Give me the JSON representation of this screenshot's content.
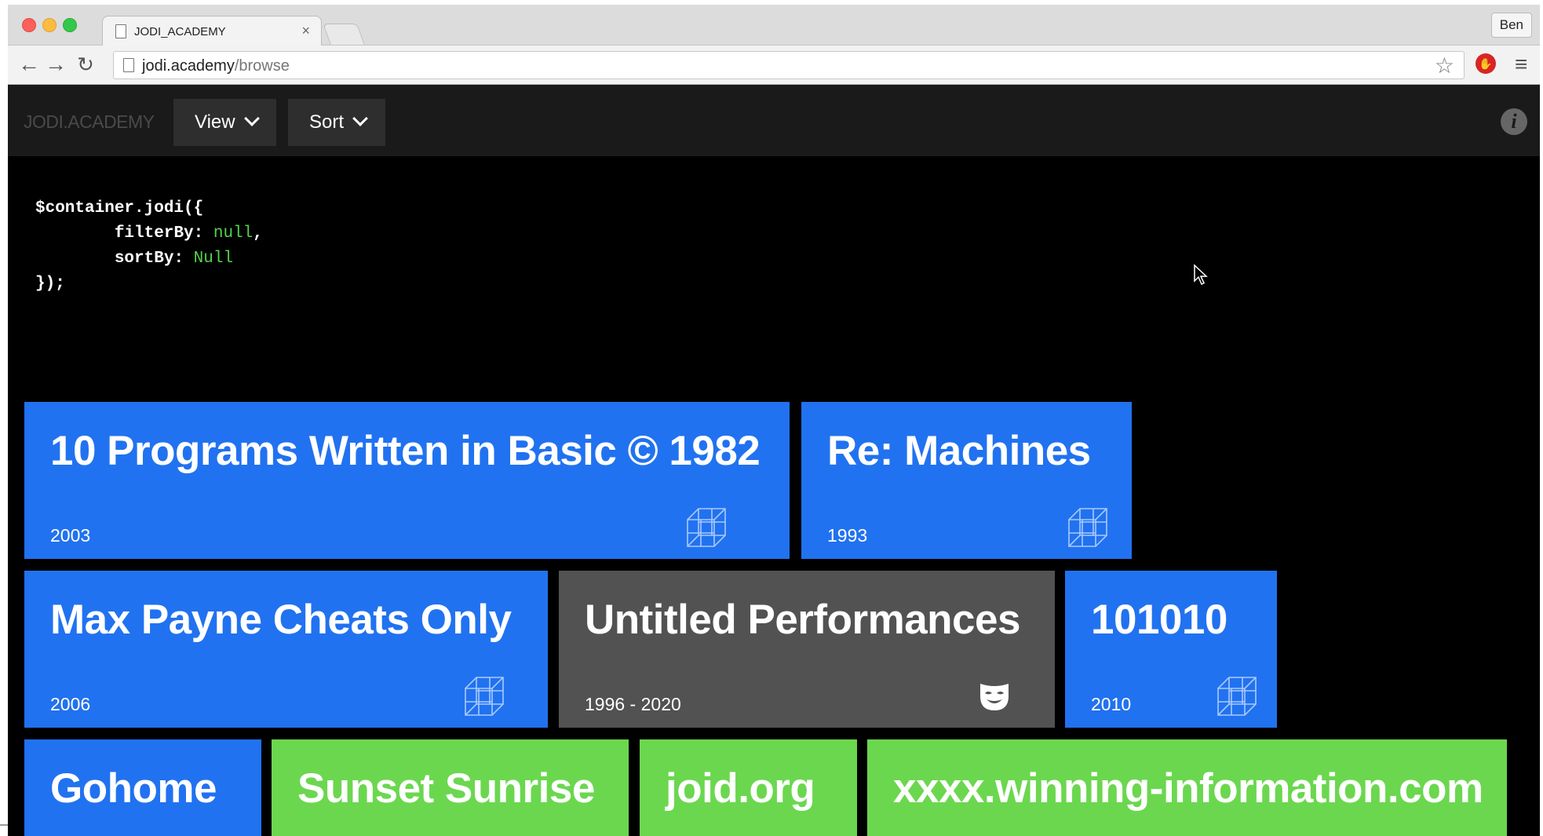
{
  "browser": {
    "tab_title": "JODI_ACADEMY",
    "tab_close": "×",
    "profile": "Ben",
    "url_host": "jodi.academy",
    "url_path": "/browse"
  },
  "site": {
    "brand": "JODI.ACADEMY",
    "view_label": "View",
    "sort_label": "Sort",
    "info_glyph": "i"
  },
  "code": {
    "line1": "$container.jodi({",
    "filter_key": "filterBy:",
    "filter_val": "null",
    "filter_comma": ",",
    "sort_key": "sortBy:",
    "sort_val": "Null",
    "line4": "});"
  },
  "tiles": [
    {
      "title": "10 Programs Written in Basic © 1982",
      "year": "2003",
      "color": "blue",
      "icon": "wireframe-cube-icon"
    },
    {
      "title": "Re: Machines",
      "year": "1993",
      "color": "blue",
      "icon": "wireframe-cube-icon"
    },
    {
      "title": "Max Payne Cheats Only",
      "year": "2006",
      "color": "blue",
      "icon": "wireframe-cube-icon"
    },
    {
      "title": "Untitled Performances",
      "year": "1996 - 2020",
      "color": "gray",
      "icon": "theater-mask-icon"
    },
    {
      "title": "101010",
      "year": "2010",
      "color": "blue",
      "icon": "wireframe-cube-icon"
    },
    {
      "title": "Gohome",
      "year": "",
      "color": "blue",
      "icon": ""
    },
    {
      "title": "Sunset Sunrise",
      "year": "",
      "color": "green",
      "icon": ""
    },
    {
      "title": "joid.org",
      "year": "",
      "color": "green",
      "icon": ""
    },
    {
      "title": "xxxx.winning-information.com",
      "year": "",
      "color": "green",
      "icon": ""
    }
  ],
  "colors": {
    "tile_blue": "#2172f0",
    "tile_gray": "#525252",
    "tile_green": "#6bd74f",
    "code_value": "#52d24b",
    "nav_bg": "#1a1a1a",
    "page_bg": "#000000"
  }
}
